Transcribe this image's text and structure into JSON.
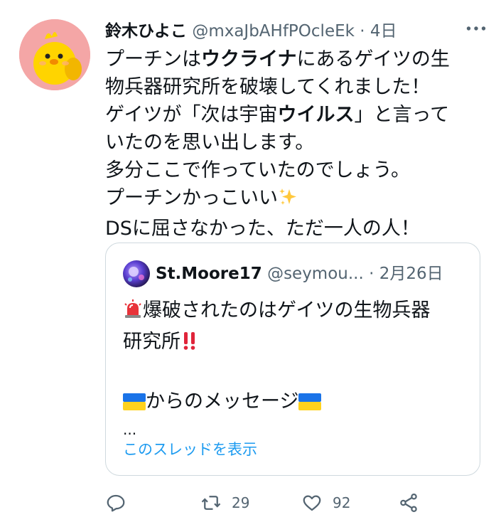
{
  "tweet": {
    "author_name": "鈴木ひよこ",
    "author_handle": "@mxaJbAHfPOcleEk",
    "separator": "·",
    "time": "4日",
    "lines": [
      {
        "parts": [
          "プーチンは",
          "ウクライナ",
          "にあるゲイツの生"
        ],
        "bold": [
          1
        ]
      },
      {
        "parts": [
          "物兵器研究所を破壊してくれました！"
        ]
      },
      {
        "parts": [
          "ゲイツが「次は宇宙",
          "ウイルス",
          "」と言って"
        ],
        "bold": [
          1
        ]
      },
      {
        "parts": [
          "いたのを思い出します。"
        ]
      },
      {
        "parts": [
          "多分ここで作っていたのでしょう。"
        ]
      },
      {
        "parts": [
          "プーチンかっこいい"
        ]
      },
      {
        "parts": [
          "DSに屈さなかった、ただ一人の人！"
        ]
      }
    ],
    "line1_a": "プーチンは",
    "line1_b": "ウクライナ",
    "line1_c": "にあるゲイツの生",
    "line2": "物兵器研究所を破壊してくれました！",
    "line3_a": "ゲイツが「次は宇宙",
    "line3_b": "ウイルス",
    "line3_c": "」と言って",
    "line4": "いたのを思い出します。",
    "line5": "多分ここで作っていたのでしょう。",
    "line6": "プーチンかっこいい",
    "line6_emoji": "sparkles-icon",
    "line7": "DSに屈さなかった、ただ一人の人！"
  },
  "quote": {
    "author_name": "St.Moore17",
    "author_handle": "@seymou...",
    "separator": "·",
    "time": "2月26日",
    "line1": "爆破されたのはゲイツの生物兵器",
    "line1_emoji": "rotating-light-icon",
    "line2": "研究所",
    "line2_emoji": "double-exclamation-icon",
    "line3": "からのメッセージ",
    "line3_emoji": "ukraine-flag-icon",
    "ellipsis": "...",
    "show_thread": "このスレッドを表示"
  },
  "actions": {
    "reply_icon": "reply-icon",
    "retweet_icon": "retweet-icon",
    "retweet_count": "29",
    "like_icon": "heart-icon",
    "like_count": "92",
    "share_icon": "share-icon"
  },
  "colors": {
    "text": "#0f1419",
    "secondary": "#536471",
    "link": "#1d9bf0",
    "border": "#cfd9de",
    "avatar_bg": "#f4a6a6"
  }
}
